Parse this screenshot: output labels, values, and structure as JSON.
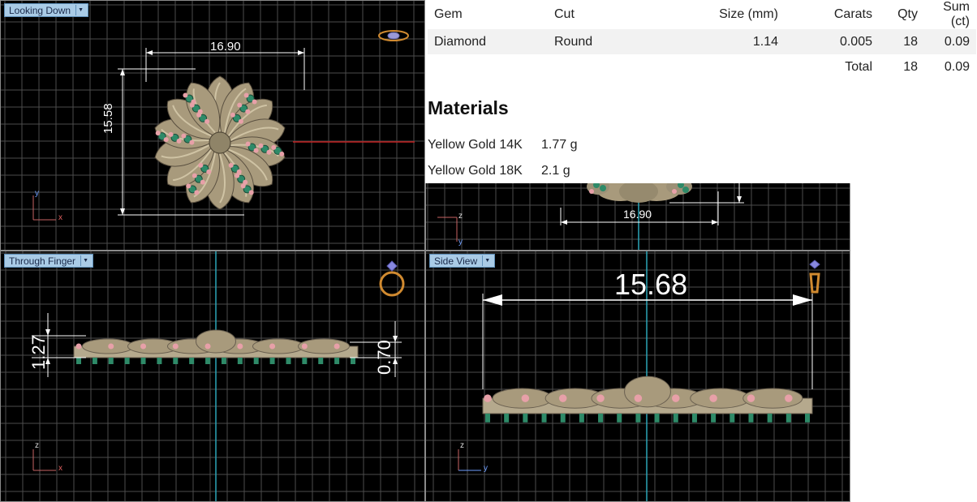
{
  "viewports": {
    "top": {
      "label": "Looking Down",
      "dim_width": "16.90",
      "dim_height": "15.58",
      "axis_up": "y",
      "axis_right": "x"
    },
    "front": {
      "label": "Through Finger",
      "dim_left": "1.27",
      "dim_right": "0.70",
      "axis_up": "z",
      "axis_right": "x"
    },
    "perspective": {
      "dim_width": "16.90",
      "axis_up": "y",
      "axis_right": "z"
    },
    "side": {
      "label": "Side View",
      "dim_width": "15.68",
      "axis_up": "z",
      "axis_right": "y"
    }
  },
  "gem_table": {
    "headers": [
      "Gem",
      "Cut",
      "Size (mm)",
      "Carats",
      "Qty",
      "Sum (ct)"
    ],
    "rows": [
      {
        "gem": "Diamond",
        "cut": "Round",
        "size": "1.14",
        "carats": "0.005",
        "qty": "18",
        "sum": "0.09"
      }
    ],
    "total": {
      "label": "Total",
      "qty": "18",
      "sum": "0.09"
    }
  },
  "materials": {
    "title": "Materials",
    "items": [
      {
        "name": "Yellow Gold 14K",
        "weight": "1.77 g"
      },
      {
        "name": "Yellow Gold 18K",
        "weight": "2.1 g"
      }
    ]
  },
  "colors": {
    "grid": "#5a5a5a",
    "axis_line": "#2aa6b8",
    "red_axis": "#c02020",
    "metal": "#a89a7c",
    "gem_green": "#2e8a68",
    "gem_pink": "#e7a0a8"
  }
}
